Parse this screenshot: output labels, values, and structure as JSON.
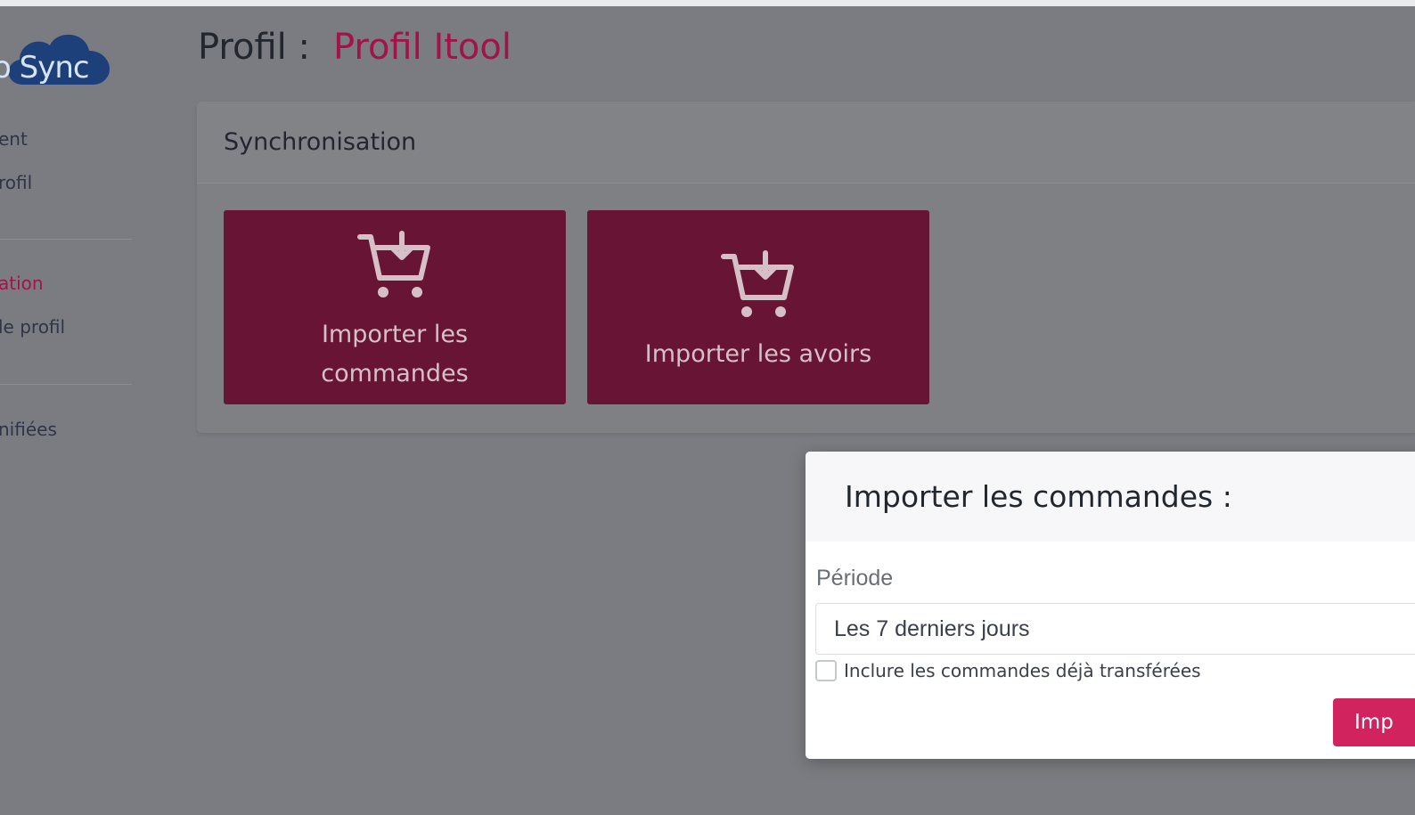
{
  "sidebar": {
    "logo_text": "o Sync",
    "items": [
      {
        "label": "ent"
      },
      {
        "label": "rofil"
      },
      {
        "label": "ation",
        "active": true
      },
      {
        "label": "le profil"
      },
      {
        "label": "nifiées"
      }
    ]
  },
  "header": {
    "label": "Profil :",
    "profile_name": "Profil Itool"
  },
  "sync_card": {
    "title": "Synchronisation",
    "actions": [
      {
        "label_line1": "Importer les",
        "label_line2": "commandes",
        "icon": "cart-download-icon"
      },
      {
        "label": "Importer les avoirs",
        "icon": "cart-download-icon"
      }
    ]
  },
  "modal": {
    "title": "Importer les commandes :",
    "period_label": "Période",
    "period_value": "Les 7 derniers jours",
    "include_transferred_label": "Inclure les commandes déjà transférées",
    "include_transferred_checked": false,
    "submit_label": "Imp"
  },
  "colors": {
    "accent": "#d1235d",
    "tile_bg": "#681535",
    "overlay_bg": "#7b7c81"
  }
}
